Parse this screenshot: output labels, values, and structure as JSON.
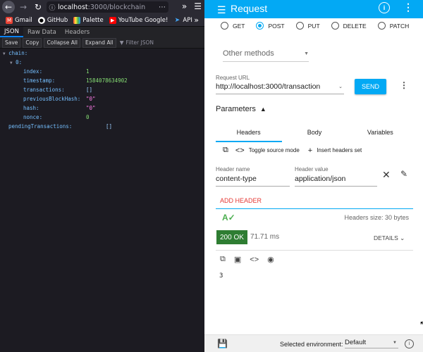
{
  "browser": {
    "url_host": "localhost",
    "url_path": ":3000/blockchain",
    "bookmarks": [
      {
        "label": "Gmail",
        "icon": "gmail-icon",
        "color": "#ea4335"
      },
      {
        "label": "GitHub",
        "icon": "github-icon",
        "color": "#ffffff"
      },
      {
        "label": "Palette",
        "icon": "palette-icon",
        "color": "#4caf50"
      },
      {
        "label": "YouTube Google!",
        "icon": "youtube-icon",
        "color": "#ff0000"
      },
      {
        "label": "API",
        "icon": "flutter-icon",
        "color": "#42a5f5"
      }
    ],
    "tabs": [
      "JSON",
      "Raw Data",
      "Headers"
    ],
    "buttons": [
      "Save",
      "Copy",
      "Collapse All",
      "Expand All"
    ],
    "filter_placeholder": "Filter JSON"
  },
  "json_tree": {
    "chain_key": "chain:",
    "index0_key": "0:",
    "fields": [
      {
        "key": "index:",
        "value": "1",
        "kind": "num"
      },
      {
        "key": "timestamp:",
        "value": "1584078634902",
        "kind": "num"
      },
      {
        "key": "transactions:",
        "value": "[]",
        "kind": "arr"
      },
      {
        "key": "previousBlockHash:",
        "value": "\"0\"",
        "kind": "str"
      },
      {
        "key": "hash:",
        "value": "\"0\"",
        "kind": "str"
      },
      {
        "key": "nonce:",
        "value": "0",
        "kind": "num"
      }
    ],
    "pending_key": "pendingTransactions:",
    "pending_value": "[]"
  },
  "app": {
    "title": "Request",
    "accent": "#03a9f4",
    "methods": [
      "GET",
      "POST",
      "PUT",
      "DELETE",
      "PATCH"
    ],
    "selected_method": "POST",
    "other_methods": "Other methods",
    "url_label": "Request URL",
    "url_value": "http://localhost:3000/transaction",
    "send_label": "SEND",
    "parameters_label": "Parameters",
    "param_tabs": [
      "Headers",
      "Body",
      "Variables"
    ],
    "toggle_source": "Toggle source mode",
    "insert_headers": "Insert headers set",
    "header_name_label": "Header name",
    "header_name_value": "content-type",
    "header_value_label": "Header value",
    "header_value_value": "application/json",
    "add_header": "ADD HEADER",
    "headers_size": "Headers size: 30 bytes",
    "status": "200 OK",
    "time": "71.71 ms",
    "details": "DETAILS",
    "response_body": "3",
    "env_label": "Selected environment:",
    "env_value": "Default"
  }
}
